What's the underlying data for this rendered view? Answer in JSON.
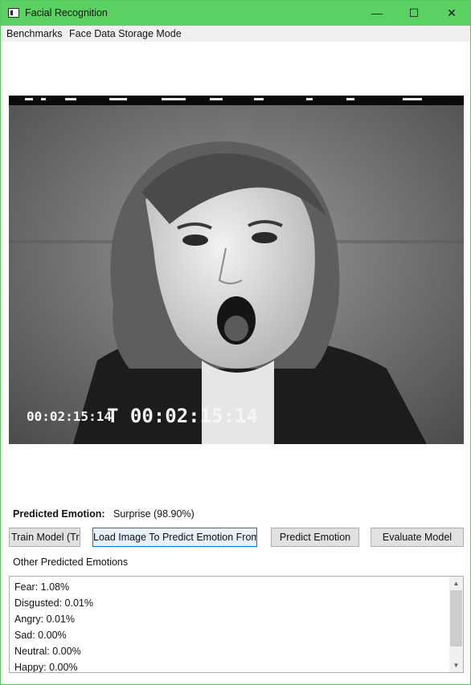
{
  "window": {
    "title": "Facial Recognition",
    "controls": {
      "minimize": "—",
      "maximize": "☐",
      "close": "✕"
    }
  },
  "menu": {
    "items": [
      "Benchmarks",
      "Face Data Storage Mode"
    ]
  },
  "image": {
    "icon": "photo-icon",
    "timecode_small": "00:02:15:14",
    "timecode_large": "T 00:02:15:14"
  },
  "prediction": {
    "label": "Predicted Emotion:",
    "value": "Surprise (98.90%)"
  },
  "buttons": {
    "train": "Train Model (Tra",
    "load": "Load Image To Predict Emotion From",
    "predict": "Predict Emotion",
    "evaluate": "Evaluate Model"
  },
  "other": {
    "label": "Other Predicted Emotions",
    "items": [
      "Fear: 1.08%",
      "Disgusted: 0.01%",
      "Angry: 0.01%",
      "Sad: 0.00%",
      "Neutral: 0.00%",
      "Happy: 0.00%"
    ]
  },
  "scrollbar": {
    "up": "▲",
    "down": "▼"
  }
}
